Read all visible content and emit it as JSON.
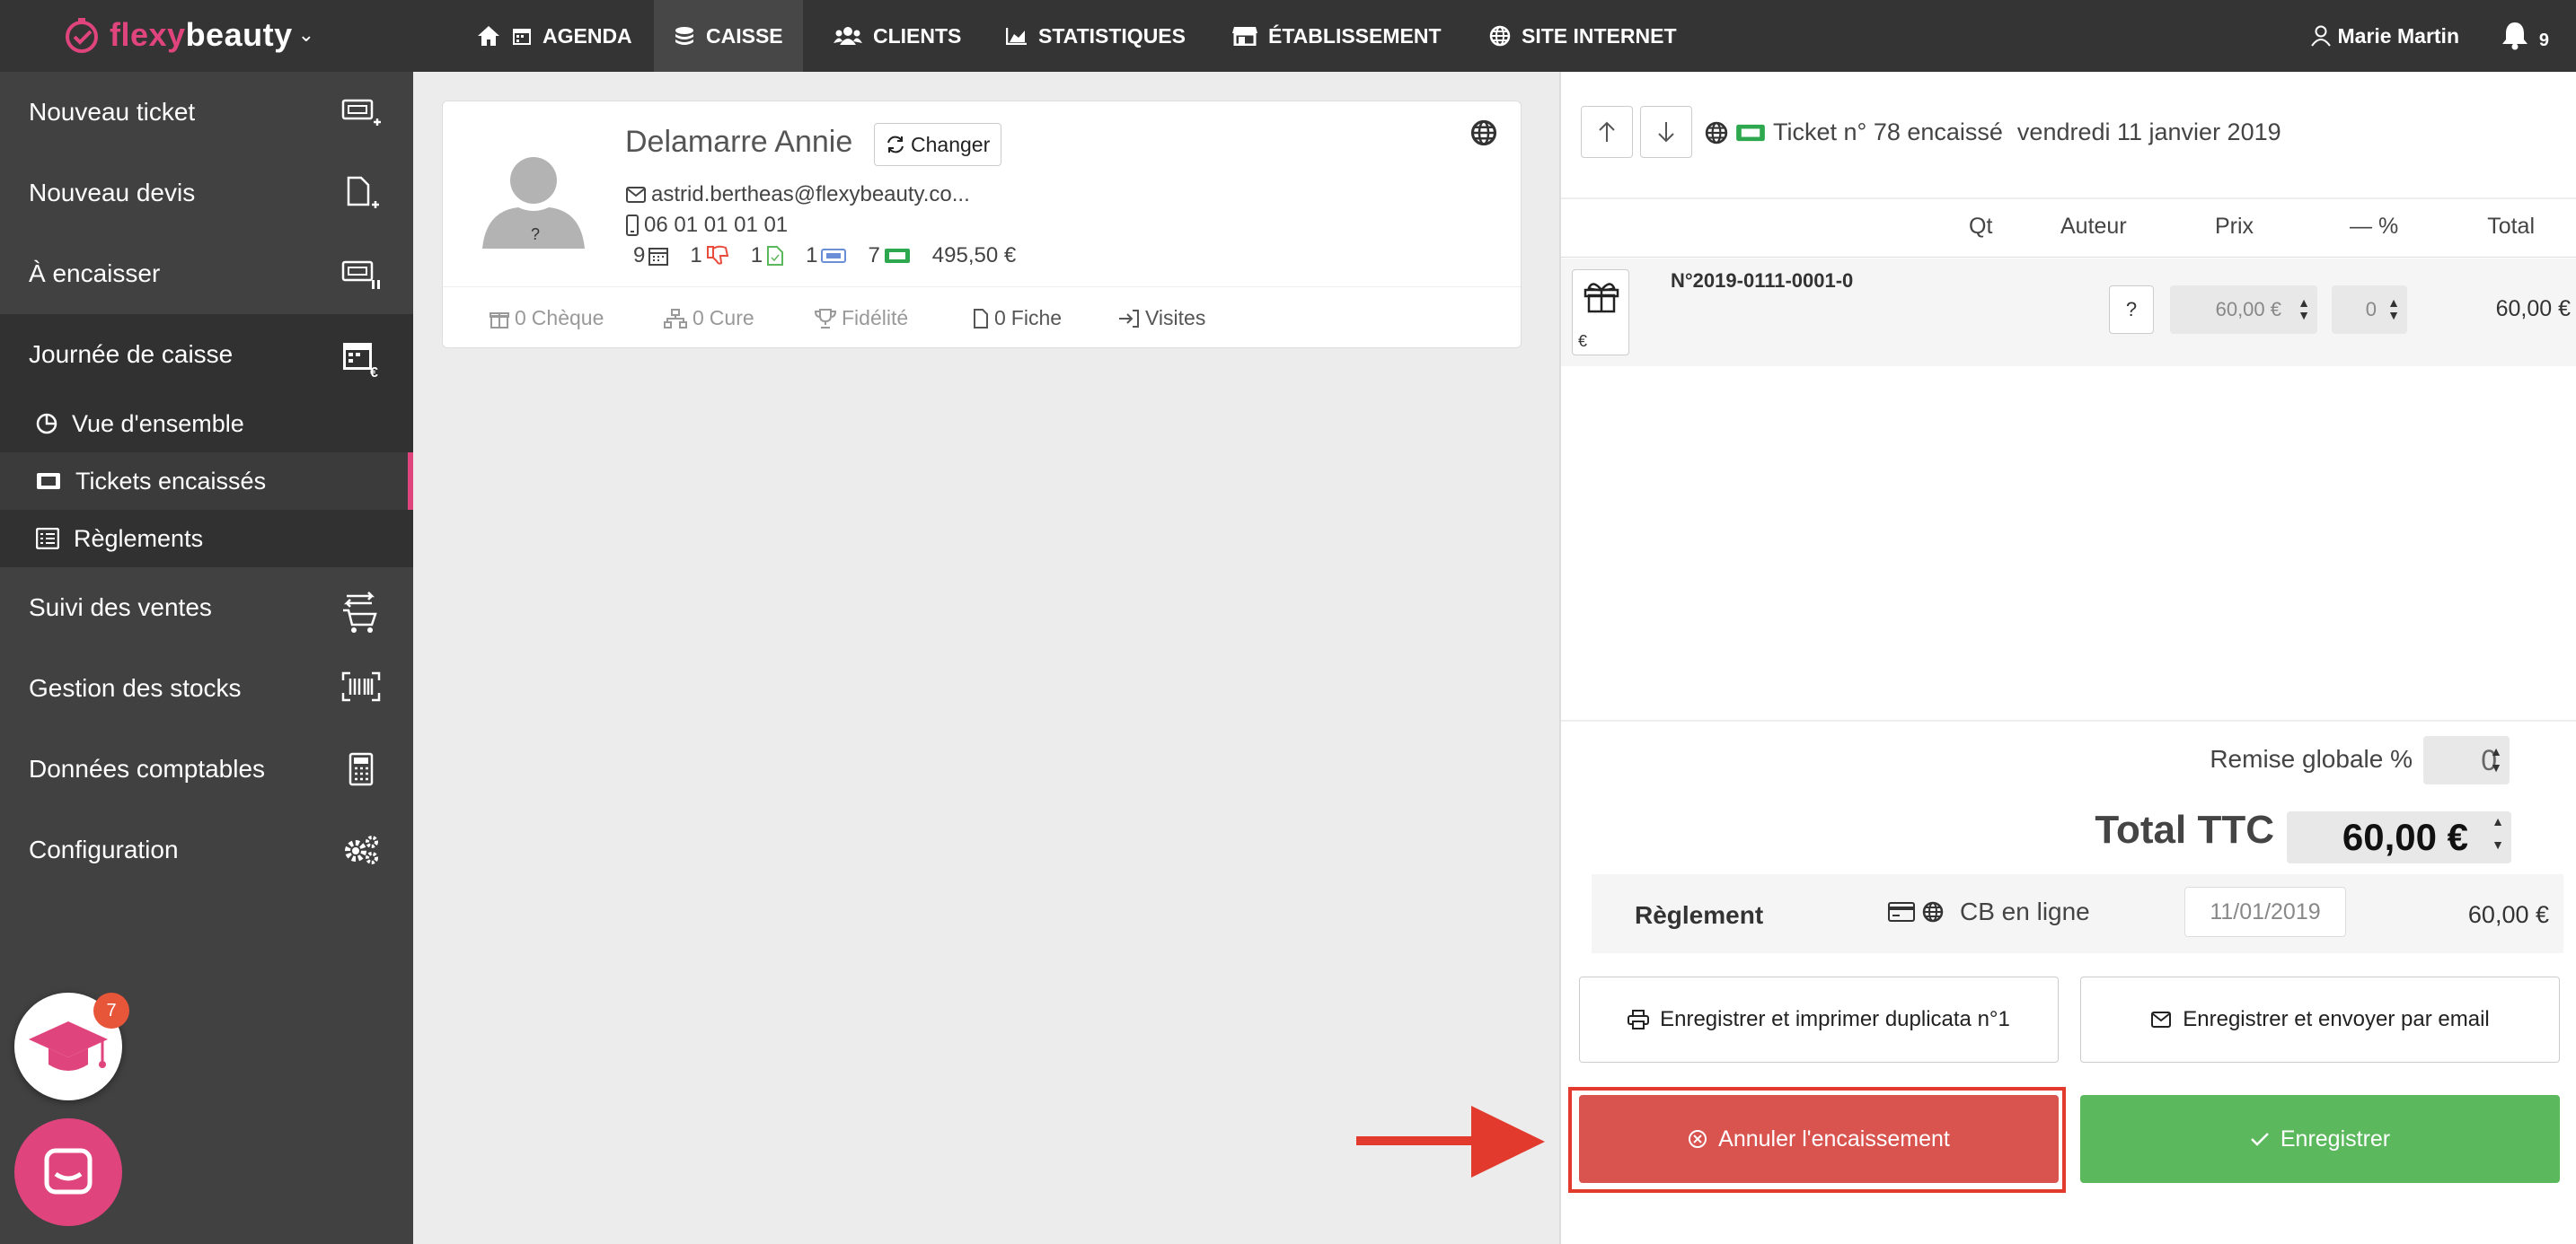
{
  "brand": {
    "part1": "flexy",
    "part2": "beauty"
  },
  "nav": {
    "agenda": "AGENDA",
    "caisse": "CAISSE",
    "clients": "CLIENTS",
    "statistiques": "STATISTIQUES",
    "etablissement": "ÉTABLISSEMENT",
    "site": "SITE INTERNET"
  },
  "user": {
    "name": "Marie Martin",
    "notifications": "9"
  },
  "sidebar": {
    "nouveau_ticket": "Nouveau ticket",
    "nouveau_devis": "Nouveau devis",
    "a_encaisser": "À encaisser",
    "journee": "Journée de caisse",
    "vue": "Vue d'ensemble",
    "tickets": "Tickets encaissés",
    "reglements": "Règlements",
    "suivi": "Suivi des ventes",
    "stocks": "Gestion des stocks",
    "comptables": "Données comptables",
    "configuration": "Configuration"
  },
  "help": {
    "count": "7"
  },
  "client": {
    "name": "Delamarre Annie",
    "changer": "Changer",
    "email": "astrid.bertheas@flexybeauty.co...",
    "phone": "06 01 01 01 01",
    "stats": {
      "rdv": "9",
      "absences": "1",
      "fiches": "1",
      "tickets": "1",
      "encaisses": "7",
      "amount": "495,50 €"
    },
    "tabs": {
      "cheque_count": "0",
      "cheque": "Chèque",
      "cure_count": "0",
      "cure": "Cure",
      "fidelite": "Fidélité",
      "fiche_count": "0",
      "fiche": "Fiche",
      "visites": "Visites"
    }
  },
  "ticket": {
    "title": "Ticket n° 78 encaissé",
    "date": "vendredi 11 janvier 2019",
    "columns": {
      "qt": "Qt",
      "auteur": "Auteur",
      "prix": "Prix",
      "pct": "— %",
      "total": "Total"
    },
    "row": {
      "euro": "€",
      "ref": "N°2019-0111-0001-0",
      "auteur": "?",
      "prix": "60,00 €",
      "pct": "0",
      "total": "60,00 €"
    },
    "remise_label": "Remise globale %",
    "remise_value": "0",
    "total_label": "Total TTC",
    "total_value": "60,00 €",
    "reglement_label": "Règlement",
    "reglement_mode": "CB en ligne",
    "reglement_date": "11/01/2019",
    "reglement_amount": "60,00 €",
    "btn_print": "Enregistrer et imprimer duplicata n°1",
    "btn_email": "Enregistrer et envoyer par email",
    "btn_cancel": "Annuler l'encaissement",
    "btn_save": "Enregistrer"
  },
  "colors": {
    "brand_pink": "#e0447d",
    "danger": "#d9534f",
    "success": "#5cb85c",
    "annotation": "#e23b2e"
  }
}
